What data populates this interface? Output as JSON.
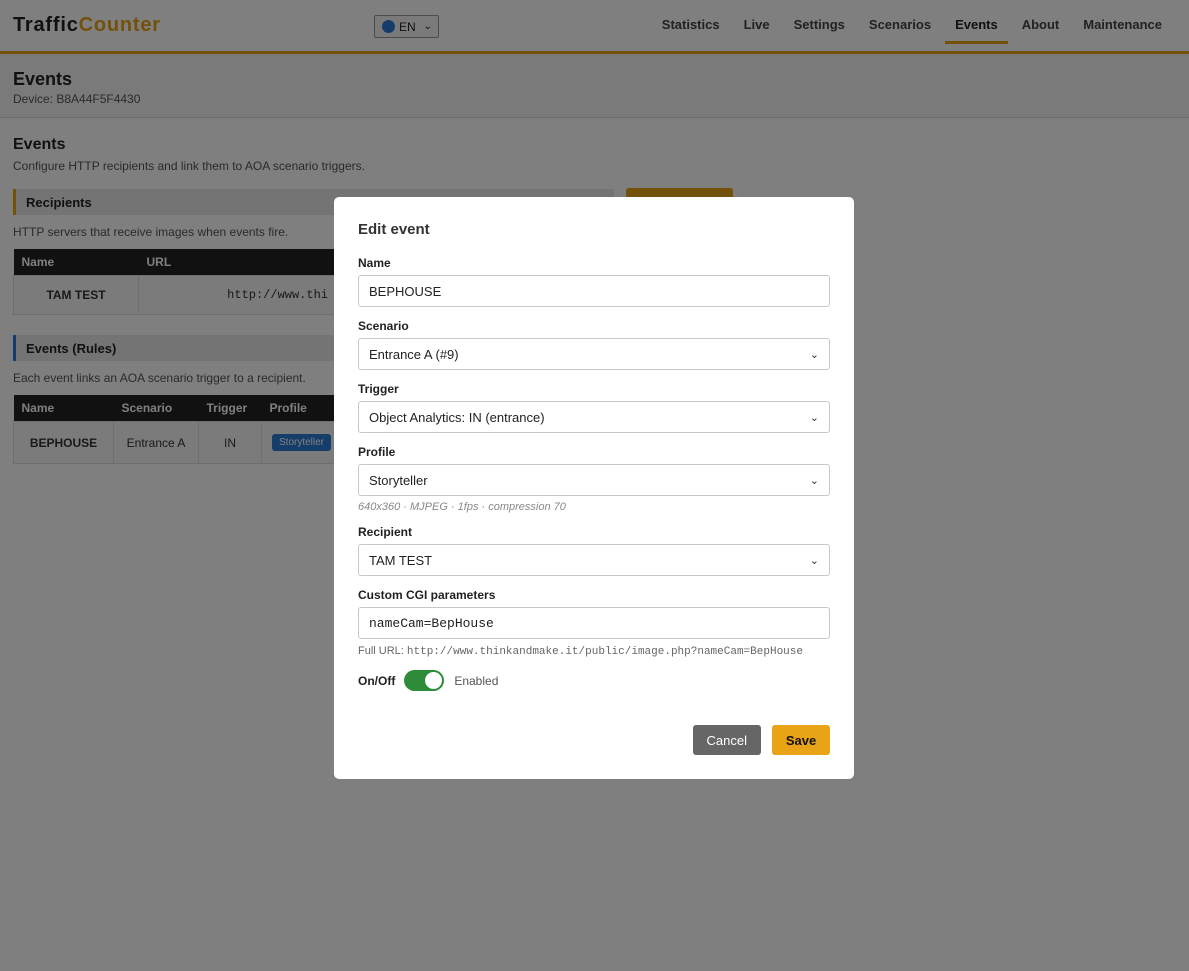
{
  "header": {
    "brand_part1": "Traffic",
    "brand_part2": "Counter",
    "language": "EN",
    "nav": [
      {
        "label": "Statistics"
      },
      {
        "label": "Live"
      },
      {
        "label": "Settings"
      },
      {
        "label": "Scenarios"
      },
      {
        "label": "Events",
        "active": true
      },
      {
        "label": "About"
      },
      {
        "label": "Maintenance"
      }
    ]
  },
  "page": {
    "title": "Events",
    "device": "Device: B8A44F5F4430"
  },
  "events_section": {
    "title": "Events",
    "description": "Configure HTTP recipients and link them to AOA scenario triggers.",
    "recipients": {
      "title": "Recipients",
      "description": "HTTP servers that receive images when events fire.",
      "columns": [
        "Name",
        "URL"
      ],
      "row": {
        "name": "TAM TEST",
        "url": "http://www.thi"
      }
    },
    "rules": {
      "title": "Events (Rules)",
      "description": "Each event links an AOA scenario trigger to a recipient.",
      "columns": [
        "Name",
        "Scenario",
        "Trigger",
        "Profile"
      ],
      "row": {
        "name": "BEPHOUSE",
        "scenario": "Entrance A",
        "trigger": "IN",
        "profile": "Storyteller"
      }
    }
  },
  "modal": {
    "title": "Edit event",
    "name_label": "Name",
    "name_value": "BEPHOUSE",
    "scenario_label": "Scenario",
    "scenario_value": "Entrance A (#9)",
    "trigger_label": "Trigger",
    "trigger_value": "Object Analytics: IN (entrance)",
    "profile_label": "Profile",
    "profile_value": "Storyteller",
    "profile_hint": "640x360 · MJPEG · 1fps · compression 70",
    "recipient_label": "Recipient",
    "recipient_value": "TAM TEST",
    "cgi_label": "Custom CGI parameters",
    "cgi_value": "nameCam=BepHouse",
    "full_url_label": "Full URL:",
    "full_url_value": "http://www.thinkandmake.it/public/image.php?nameCam=BepHouse",
    "onoff_label": "On/Off",
    "onoff_state": "Enabled",
    "cancel_label": "Cancel",
    "save_label": "Save"
  },
  "colors": {
    "accent": "#e8a317",
    "blue": "#2a7bd5",
    "toggle_on": "#2e8b3a"
  }
}
